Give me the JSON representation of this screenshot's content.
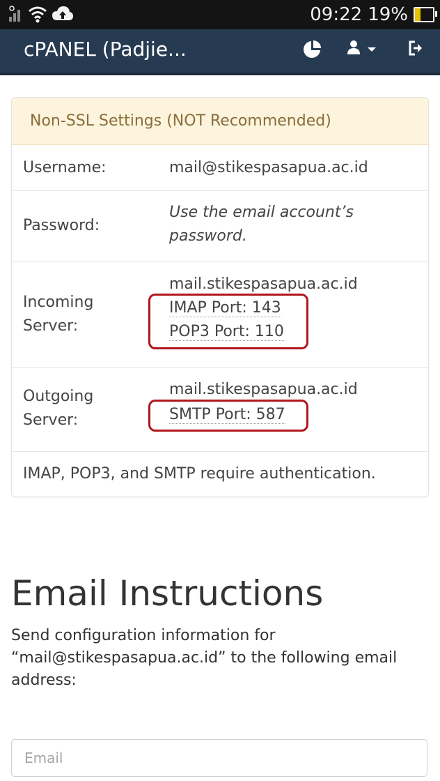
{
  "status_bar": {
    "time": "09:22",
    "battery_percent": "19%",
    "icons": [
      "signal-icon",
      "wifi-icon",
      "cloud-upload-icon",
      "battery-charging-icon"
    ]
  },
  "header": {
    "title": "cPANEL (Padjie...",
    "icons": [
      "pie-chart-icon",
      "user-icon",
      "chevron-down-icon",
      "logout-icon"
    ],
    "color": "#263b52"
  },
  "settings": {
    "heading": "Non-SSL Settings (NOT Recommended)",
    "username": {
      "label": "Username:",
      "value": "mail@stikespasapua.ac.id"
    },
    "password": {
      "label": "Password:",
      "value_line1": "Use the email account’s",
      "value_line2": "password."
    },
    "incoming": {
      "label_line1": "Incoming",
      "label_line2": "Server:",
      "host": "mail.stikespasapua.ac.id",
      "imap_port": "IMAP Port: 143",
      "pop3_port": "POP3 Port: 110"
    },
    "outgoing": {
      "label_line1": "Outgoing",
      "label_line2": "Server:",
      "host": "mail.stikespasapua.ac.id",
      "smtp_port": "SMTP Port: 587"
    },
    "note": "IMAP, POP3, and SMTP require authentication.",
    "highlight_color": "#b0171c"
  },
  "instructions": {
    "title": "Email Instructions",
    "description_line1": "Send configuration information for",
    "description_line2": "“mail@stikespasapua.ac.id” to the following email",
    "description_line3": "address:",
    "email_placeholder": "Email"
  }
}
